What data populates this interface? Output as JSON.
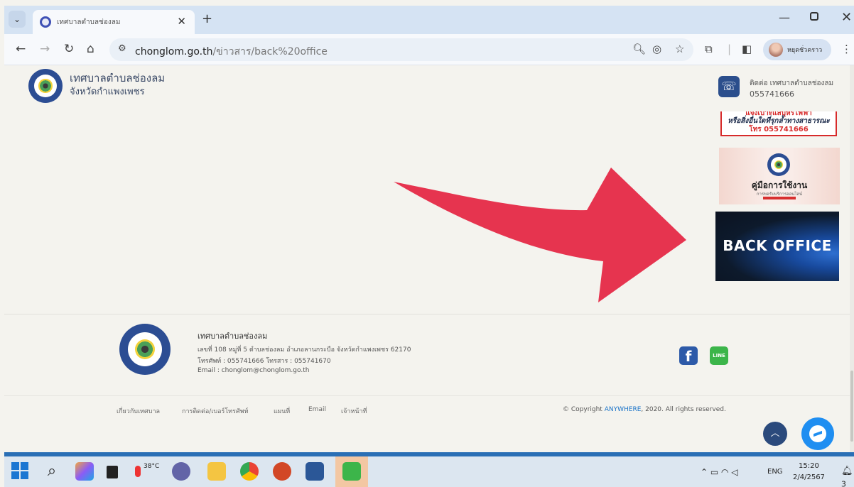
{
  "browser": {
    "tab_title": "เทศบาลตำบลช่องลม",
    "tab_close": "✕",
    "new_tab": "+",
    "tab_dropdown": "⌄",
    "url_host": "chonglom.go.th",
    "url_path": "/ข่าวสาร/back%20office",
    "profile_name": "หยุดชั่วคราว",
    "window_min": "—",
    "window_close": "✕"
  },
  "header": {
    "site_name": "เทศบาลตำบลช่องลม",
    "province": "จังหวัดกำแพงเพชร"
  },
  "sidebar": {
    "contact_label": "ติดต่อ เทศบาลตำบลช่องลม",
    "contact_phone": "055741666",
    "report_line1": "แจ้งเบาะแสบุหรี่ไฟฟ้า",
    "report_line2": "หรือสิ่งอื่นใดที่รุกล้ำทางสาธารณะ",
    "report_line3": "โทร 055741666",
    "manual_title": "คู่มือการใช้งาน",
    "manual_subtitle": "การขอรับบริการออนไลน์",
    "backoffice_label": "BACK OFFICE"
  },
  "footer": {
    "name": "เทศบาลตำบลช่องลม",
    "address": "เลขที่ 108 หมู่ที่ 5 ตำบลช่องลม อำเภอลานกระบือ จังหวัดกำแพงเพชร 62170",
    "phone_line": "โทรศัพท์ :  055741666      โทรสาร :  055741670",
    "email_line": "Email :  chonglom@chonglom.go.th",
    "line_badge": "LINE",
    "links": [
      "เกี่ยวกับเทศบาล",
      "การติดต่อ/เบอร์โทรศัพท์",
      "แผนที่",
      "Email",
      "เจ้าหน้าที่"
    ],
    "copyright_prefix": "© Copyright ",
    "copyright_brand": "ANYWHERE",
    "copyright_suffix": ", 2020. All rights reserved."
  },
  "taskbar": {
    "weather_temp": "38°C",
    "lang": "ENG",
    "time": "15:20",
    "date": "2/4/2567",
    "notification_count": "3"
  },
  "colors": {
    "accent_blue": "#2b4e8c",
    "arrow_red": "#e6344f",
    "facebook": "#2d5aa8",
    "line": "#3cb54a",
    "messenger": "#1f8ef1"
  }
}
